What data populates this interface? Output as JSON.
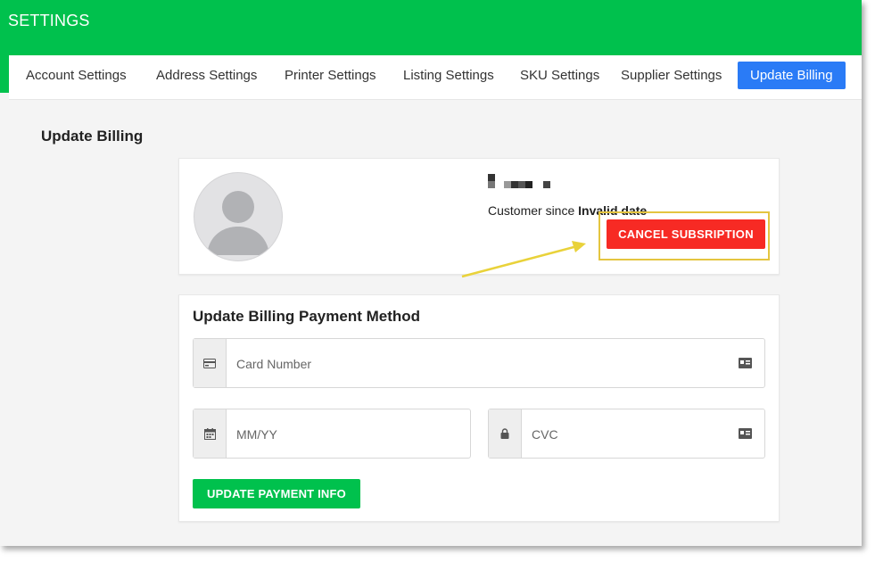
{
  "header": {
    "title": "SETTINGS"
  },
  "tabs": [
    {
      "label": "Account Settings",
      "active": false
    },
    {
      "label": "Address Settings",
      "active": false
    },
    {
      "label": "Printer Settings",
      "active": false
    },
    {
      "label": "Listing Settings",
      "active": false
    },
    {
      "label": "SKU Settings",
      "active": false
    },
    {
      "label": "Supplier Settings",
      "active": false
    },
    {
      "label": "Update Billing",
      "active": true
    }
  ],
  "page": {
    "heading": "Update Billing"
  },
  "profile": {
    "avatar_icon": "user-silhouette-icon",
    "customer_since_label": "Customer since",
    "customer_since_value": "Invalid date",
    "cancel_button_label": "CANCEL SUBSRIPTION"
  },
  "payment": {
    "heading": "Update Billing Payment Method",
    "card_number": {
      "value": "",
      "placeholder": "Card Number",
      "icon": "credit-card-icon",
      "trail_icon": "id-card-icon"
    },
    "expiry": {
      "value": "",
      "placeholder": "MM/YY",
      "icon": "calendar-icon"
    },
    "cvc": {
      "value": "",
      "placeholder": "CVC",
      "icon": "lock-icon",
      "trail_icon": "id-card-icon"
    },
    "submit_label": "UPDATE PAYMENT INFO"
  },
  "colors": {
    "brand_green": "#00c14d",
    "active_tab_blue": "#2a7bf6",
    "danger_red": "#f72a24",
    "annotation_yellow": "#e4c540"
  }
}
